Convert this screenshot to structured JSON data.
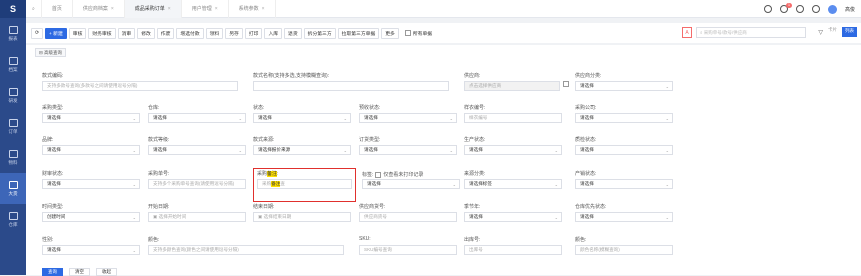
{
  "sidebar": {
    "logo": "S",
    "items": [
      {
        "label": "报表",
        "icon": "chart-icon"
      },
      {
        "label": "档案",
        "icon": "archive-icon"
      },
      {
        "label": "研发",
        "icon": "shirt-icon"
      },
      {
        "label": "订单",
        "icon": "order-icon"
      },
      {
        "label": "物料",
        "icon": "material-icon"
      },
      {
        "label": "大货",
        "icon": "bulk-icon"
      },
      {
        "label": "仓库",
        "icon": "warehouse-icon"
      }
    ]
  },
  "topbar": {
    "tabs": [
      {
        "label": "首页"
      },
      {
        "label": "供应商档案"
      },
      {
        "label": "成品采购订单"
      },
      {
        "label": "用户管理"
      },
      {
        "label": "系统参数"
      }
    ],
    "badge": "1",
    "user": "高俊"
  },
  "toolbar": {
    "new": "+ 新建",
    "buttons": [
      "审核",
      "财务审核",
      "消审",
      "修改",
      "作废",
      "增选付款",
      "领料",
      "另存",
      "打印",
      "入库",
      "退货",
      "拆分第三方",
      "拉取第三方单据",
      "更多"
    ],
    "all_orders": "所有单据",
    "ac_tag": "A",
    "search_placeholder": "采购单号/款号/供应商",
    "right_tools": [
      "卡片",
      "列表"
    ]
  },
  "form": {
    "advanced": "高级查询",
    "fields": [
      {
        "label": "款式编码:",
        "placeholder": "支持多款号查询(多款号之间请使用逗号分隔)"
      },
      {
        "label": "款式名称(支持多选,支持模糊查询):",
        "placeholder": ""
      },
      {
        "label": "供应商:",
        "placeholder": "点击选择供应商"
      },
      {
        "label": "供应商分类:",
        "value": "请选择"
      },
      {
        "label": "采购类型:",
        "value": "请选择"
      },
      {
        "label": "仓库:",
        "value": "请选择"
      },
      {
        "label": "状态:",
        "value": "请选择"
      },
      {
        "label": "预收状态:",
        "value": "请选择"
      },
      {
        "label": "样衣编号:",
        "placeholder": "样衣编号"
      },
      {
        "label": "采购公司:",
        "value": "请选择"
      },
      {
        "label": "品牌:",
        "value": "请选择"
      },
      {
        "label": "款式等级:",
        "value": "请选择"
      },
      {
        "label": "款式来源:",
        "value": "请选择报价来源"
      },
      {
        "label": "订货类型:",
        "value": "请选择"
      },
      {
        "label": "生产状态:",
        "value": "请选择"
      },
      {
        "label": "质检状态:",
        "value": "请选择"
      },
      {
        "label": "财审状态:",
        "value": "请选择"
      },
      {
        "label": "采购单号:",
        "placeholder": "支持多个采购单号查询(请使用逗号分隔)"
      },
      {
        "label_pre": "采购",
        "label_mark": "备注",
        "label_post": ":",
        "placeholder_pre": "采购",
        "placeholder_mark": "备注",
        "placeholder_post": "查"
      },
      {
        "label": "标签:",
        "value": "请选择",
        "check_label": "仅查看未打印记录"
      },
      {
        "label": "来源分类:",
        "value": "请选择标签"
      },
      {
        "label": "产销状态:",
        "value": "请选择"
      },
      {
        "label": "时间类型:",
        "value": "创建时间"
      },
      {
        "label": "开始日期:",
        "placeholder": "选择开始时间"
      },
      {
        "label": "结束日期:",
        "placeholder": "选择结束日期"
      },
      {
        "label": "供应商货号:",
        "placeholder": "供应商货号"
      },
      {
        "label": "季节年:",
        "value": "请选择"
      },
      {
        "label": "仓库优先状态:",
        "value": "请选择"
      },
      {
        "label": "性别:",
        "value": "请选择"
      },
      {
        "label": "颜色:",
        "placeholder": "支持多颜色查询(颜色之间请使用逗号分隔)"
      },
      {
        "label": "SKU:",
        "placeholder": "SKU编号查询"
      },
      {
        "label": "出库号:",
        "placeholder": "出库号"
      },
      {
        "label": "颜色:",
        "placeholder": "颜色名称(模糊查询)"
      }
    ],
    "bottom_buttons": [
      "查询",
      "清空",
      "收起"
    ]
  },
  "colors": {
    "primary": "#2d6ae3",
    "sidebar": "#2b4a8a",
    "highlight": "#e0302d"
  }
}
